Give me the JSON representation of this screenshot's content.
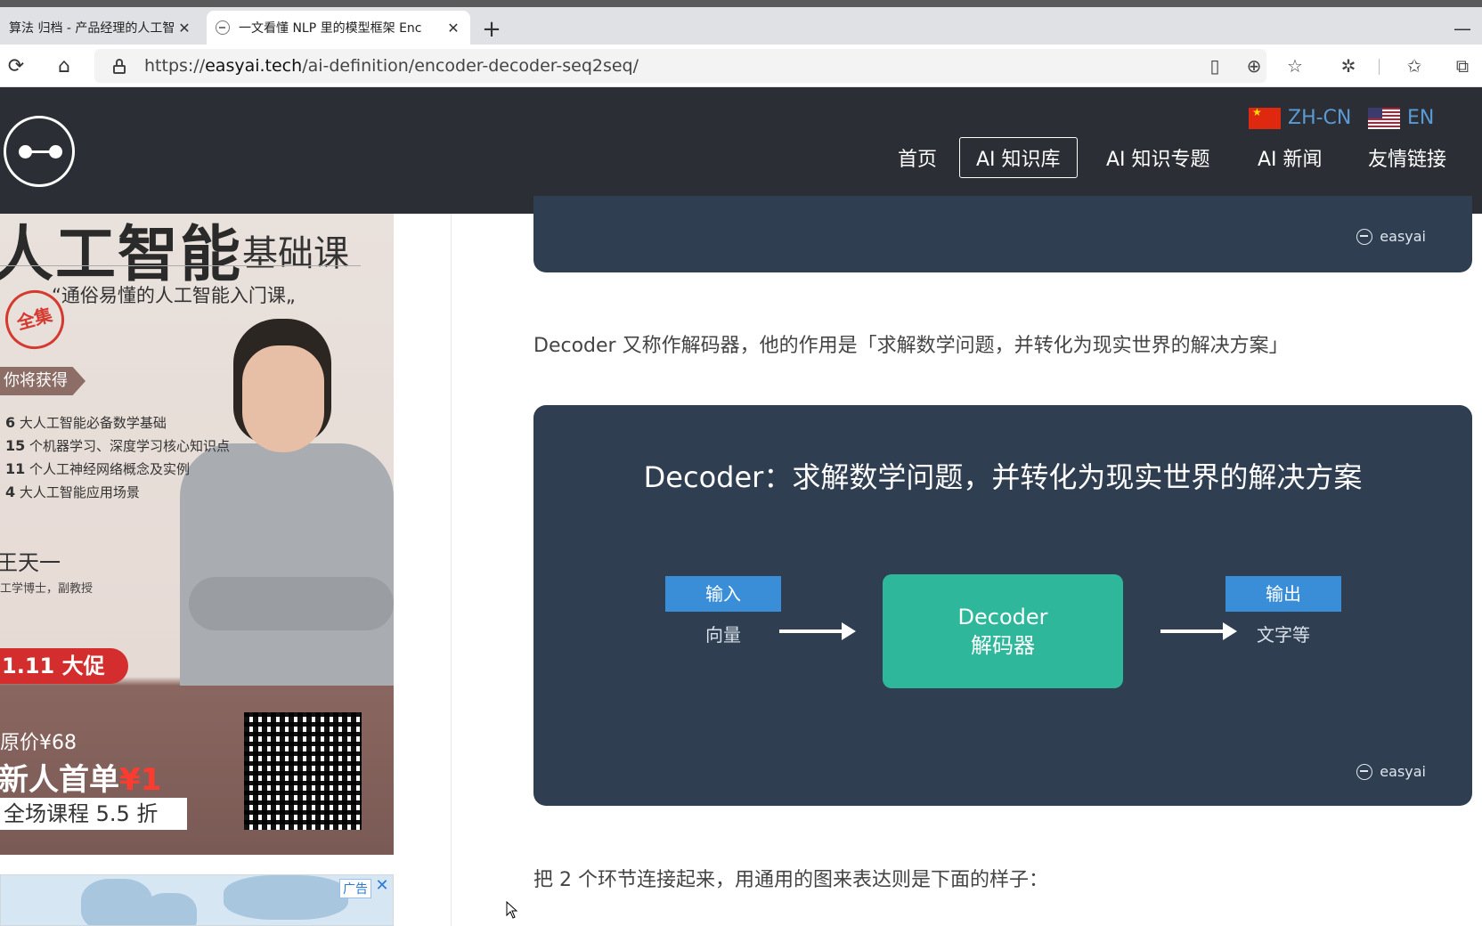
{
  "browser": {
    "tabs": [
      {
        "title": "算法 归档 - 产品经理的人工智"
      },
      {
        "title": "一文看懂 NLP 里的模型框架 Enc"
      }
    ],
    "url_scheme": "https://",
    "url_host": "easyai.tech",
    "url_path": "/ai-definition/encoder-decoder-seq2seq/"
  },
  "site": {
    "lang_zh": "ZH-CN",
    "lang_en": "EN",
    "nav": [
      "首页",
      "AI 知识库",
      "AI 知识专题",
      "AI 新闻",
      "友情链接"
    ],
    "active_nav": "AI 知识库"
  },
  "sidebar_ad": {
    "title": "人工智能",
    "subtitle": "基础课",
    "quote": "“通俗易懂的人工智能入门课„",
    "stamp": "全集",
    "gain_label": "你将获得",
    "list": [
      {
        "n": "6",
        "text": "大人工智能必备数学基础"
      },
      {
        "n": "15",
        "text": "个机器学习、深度学习核心知识点"
      },
      {
        "n": "11",
        "text": "个人工神经网络概念及实例"
      },
      {
        "n": "4",
        "text": "大人工智能应用场景"
      }
    ],
    "name": "王天一",
    "role": "工学博士，副教授",
    "promo": "1.11 大促",
    "original_price": "原价¥68",
    "new_user": "新人首单",
    "new_price": "¥1",
    "discount": "全场课程 5.5 折"
  },
  "ad2": {
    "tag": "广告",
    "close": "✕"
  },
  "article": {
    "watermark": "easyai",
    "para1": "Decoder 又称作解码器，他的作用是「求解数学问题，并转化为现实世界的解决方案」",
    "para2": "把 2 个环节连接起来，用通用的图来表达则是下面的样子：",
    "diagram": {
      "title": "Decoder：求解数学问题，并转化为现实世界的解决方案",
      "input_label": "输入",
      "input_sub": "向量",
      "box_line1": "Decoder",
      "box_line2": "解码器",
      "output_label": "输出",
      "output_sub": "文字等"
    }
  },
  "colors": {
    "header_bg": "#2b2e35",
    "panel_bg": "#2f3e50",
    "decoder_green": "#2eb79b",
    "io_blue": "#3a8ed8"
  }
}
